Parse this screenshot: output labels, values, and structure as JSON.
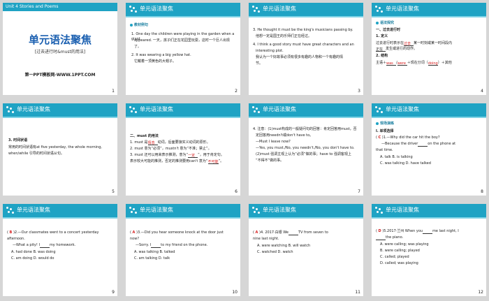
{
  "slides": [
    {
      "num": "1",
      "unit": "Unit 4  Stories and Poems",
      "title": "单元语法聚焦",
      "subtitle": "[过去进行时&must的用法]",
      "footer": "第一PPT模板网-WWW.1PPT.COM"
    },
    {
      "num": "2",
      "header": "单元语法聚焦",
      "tag": "教材例句",
      "lines": [
        "1.    One day the children were playing in the garden when a giant",
        "appeared.  一天，孩子们正在花园里玩耍，这时一个巨人出现",
        "了。",
        "2.    It was wearing a big yellow hat.",
        "它戴着一顶黄色的大帽子。"
      ]
    },
    {
      "num": "3",
      "header": "单元语法聚焦",
      "lines": [
        "3.    He thought it must be the king's musicians passing by.",
        "他想一定是国王的乐师们正在经过。",
        "4.    I think a good story must have great characters  and  an",
        "interesting plot.",
        "我认为一个好故事必须有很多有趣的人物和一个有趣的情",
        "节。"
      ]
    },
    {
      "num": "4",
      "header": "单元语法聚焦",
      "tag": "语法探究",
      "lines": [
        "一、过去进行时",
        "1. 定义",
        "过去进行时表示在",
        "某一时刻或某一时间段内",
        "正在",
        "发生或进行的动作。",
        "2. 结构",
        "主语＋",
        "＋现在分词（",
        "）＋其他"
      ],
      "answers": [
        "过去",
        "was",
        "were",
        "doing"
      ]
    },
    {
      "num": "5",
      "header": "单元语法聚焦",
      "lines": [
        "3.    时间状语",
        "常用的时间状语有at five yesterday, the whole morning,",
        "when/while 引导的时间状语从句。"
      ]
    },
    {
      "num": "6",
      "header": "单元语法聚焦",
      "lines": [
        "二、must 的用法",
        "1. must 是",
        "动词，后面要接实义动词的原形。",
        "2. must 意为“必须”，mustn't 意为“不准；禁止”。",
        "3. must 还可以用来表示推测，意为“",
        "”，用于肯定句。",
        "表示较大可能的推测，否定的推测要用can't 意为“",
        "”。"
      ],
      "answers": [
        "情态",
        "一定",
        "不可能"
      ]
    },
    {
      "num": "7",
      "header": "单元语法聚焦",
      "lines": [
        "4. 注意：(1)must构成的一般疑问句的回答：肯定回答用must，否",
        "定回答用needn't或don't have to。",
        "—Must I leave now?",
        "—Yes, you must./No, you needn't./No, you don't have to.",
        "(2)must 强调主观上认为“必须”做的事；have to 强调客观上",
        "“不得不”做的事。"
      ]
    },
    {
      "num": "8",
      "header": "单元语法聚焦",
      "tag": "现场演练",
      "lines": [
        "Ⅰ. 单项选择",
        "1.—Why did the car hit the boy?",
        "—Because the driver",
        "on the phone at",
        "that time.",
        "A. talk        B. is talking",
        "C. was talking      D. have talked"
      ],
      "answers": [
        "C"
      ]
    },
    {
      "num": "9",
      "header": "单元语法聚焦",
      "lines": [
        "2.—Our classmates went to a concert yesterday",
        "afternoon.",
        "—What a pity! I",
        "my homework.",
        "A. had done    B. was doing",
        "C. am doing    D. would do"
      ],
      "answers": [
        "B"
      ]
    },
    {
      "num": "10",
      "header": "单元语法聚焦",
      "lines": [
        "3.—Did you hear someone knock at the door just",
        "now?",
        "—Sorry. I",
        "to my friend on the phone.",
        "A. was talking    B. talked",
        "C. am talking    D. talk"
      ],
      "answers": [
        "A"
      ]
    },
    {
      "num": "11",
      "header": "单元语法聚焦",
      "lines": [
        "4. 2017·白银   We",
        "TV from seven to",
        "nine last night.",
        "A. were watching    B. will watch",
        "C. watched    D. watch"
      ],
      "answers": [
        "A"
      ]
    },
    {
      "num": "12",
      "header": "单元语法聚焦",
      "lines": [
        "5.2017·兰州   When you",
        "me last night,",
        "the piano.",
        "A. were calling; was playing",
        "B. were calling; played",
        "C. called; played",
        "D. called; was playing"
      ],
      "answers": [
        "D",
        "I"
      ]
    }
  ]
}
